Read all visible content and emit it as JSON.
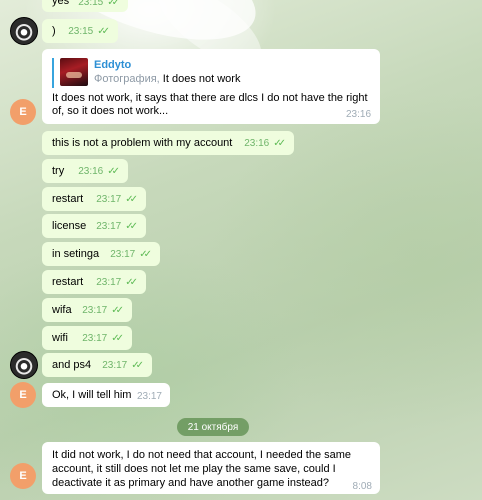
{
  "messages": [
    {
      "text": "yes",
      "time": "23:15"
    },
    {
      "text": ")",
      "time": "23:15"
    },
    {
      "reply_to": {
        "name": "Eddyto",
        "kind": "Фотография,",
        "text": "It does not work"
      },
      "text_lines": [
        "It does not work, it says that there are dlcs I do not have the right",
        "of, so it does not work..."
      ],
      "time": "23:16"
    },
    {
      "text": "this is not a problem with my account",
      "time": "23:16"
    },
    {
      "text": "try",
      "time": "23:16"
    },
    {
      "text": "restart",
      "time": "23:17"
    },
    {
      "text": "license",
      "time": "23:17"
    },
    {
      "text": "in setinga",
      "time": "23:17"
    },
    {
      "text": "restart",
      "time": "23:17"
    },
    {
      "text": "wifa",
      "time": "23:17"
    },
    {
      "text": "wifi",
      "time": "23:17"
    },
    {
      "text": "and ps4",
      "time": "23:17"
    },
    {
      "text": "Ok, I will tell him",
      "time": "23:17"
    },
    {
      "text_lines": [
        "It did not work, I do not need that account, I needed  the same",
        "account, it still does not let me play the same save, could I",
        "deactivate it as primary and have another game instead?"
      ],
      "time": "8:08"
    }
  ],
  "date_separator": "21 октября",
  "avatars": {
    "user_initial": "E"
  },
  "icons": {
    "read": "double-check-icon"
  }
}
